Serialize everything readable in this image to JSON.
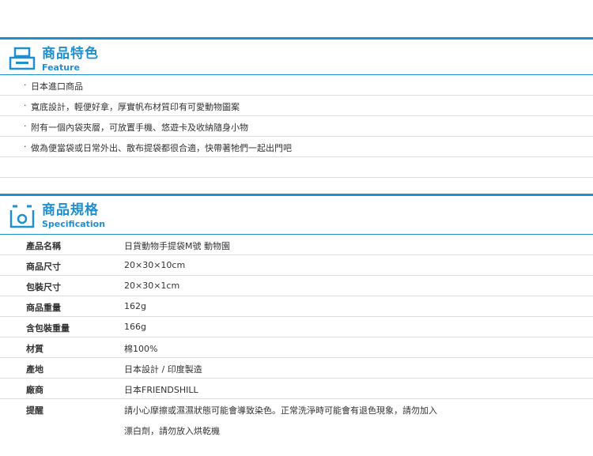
{
  "feature": {
    "title": "商品特色",
    "subtitle": "Feature",
    "bullet": "·",
    "items": [
      "日本進口商品",
      "寬底設計，輕便好拿，厚實帆布材質印有可愛動物圖案",
      "附有一個內袋夾層，可放置手機、悠遊卡及收納隨身小物",
      "做為便當袋或日常外出、散布提袋都很合適，快帶著牠們一起出門吧"
    ]
  },
  "spec": {
    "title": "商品規格",
    "subtitle": "Specification",
    "rows": [
      {
        "label": "產品名稱",
        "value": "日貨動物手提袋M號 動物園"
      },
      {
        "label": "商品尺寸",
        "value": "20×30×10cm"
      },
      {
        "label": "包裝尺寸",
        "value": "20×30×1cm"
      },
      {
        "label": "商品重量",
        "value": "162g"
      },
      {
        "label": "含包裝重量",
        "value": "166g"
      },
      {
        "label": "材質",
        "value": "棉100%"
      },
      {
        "label": "產地",
        "value": "日本設計 / 印度製造"
      },
      {
        "label": "廠商",
        "value": "日本FRIENDSHILL"
      },
      {
        "label": "提醒",
        "value": "請小心摩擦或濕濕狀態可能會導致染色。正常洗淨時可能會有退色現象，請勿加入",
        "value2": "漂白劑，請勿放入烘乾機"
      }
    ]
  },
  "colors": {
    "accent": "#1f8fcf",
    "divider": "#dddddd"
  }
}
